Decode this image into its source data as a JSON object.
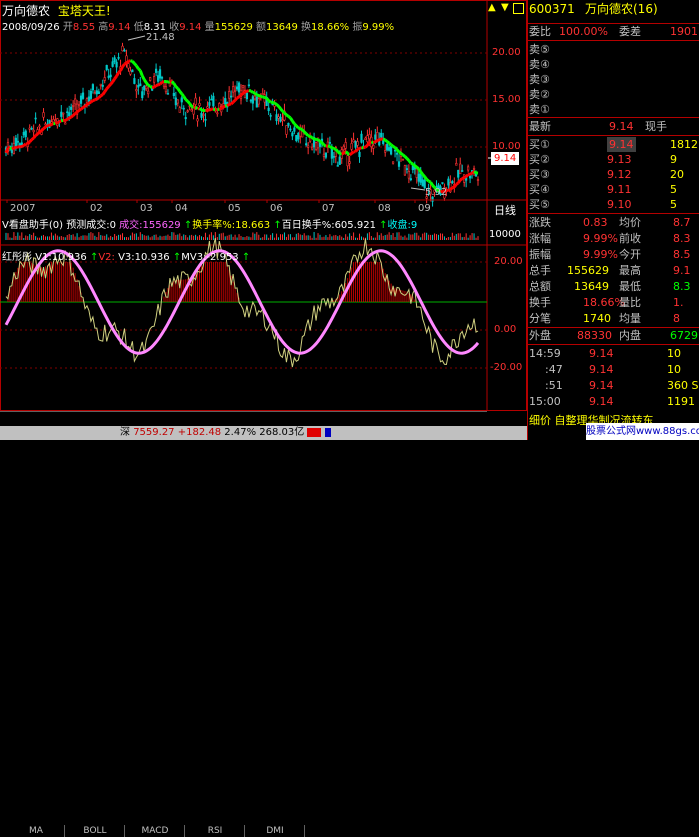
{
  "stock": {
    "name": "万向德农",
    "slogan": "宝塔天王!"
  },
  "info_line": {
    "date": "2008/09/26",
    "open_label": "开",
    "open": "8.55",
    "high_label": "高",
    "high": "9.14",
    "low_label": "低",
    "low": "8.31",
    "close_label": "收",
    "close": "9.14",
    "vol_label": "量",
    "vol": "155629",
    "amt_label": "额",
    "amt": "13649",
    "turn_label": "换",
    "turn": "18.66%",
    "amp_label": "振",
    "amp": "9.99%"
  },
  "main_chart": {
    "y_ticks": [
      "20.00",
      "15.00",
      "10.00"
    ],
    "max_label": "21.48",
    "min_label": "5.92",
    "last_price_tag": "9.14",
    "x_labels": [
      "2007",
      "02",
      "03",
      "04",
      "05",
      "06",
      "07",
      "08",
      "09"
    ],
    "period_label": "日线"
  },
  "volume_panel": {
    "title": "V看盘助手(0)",
    "pred_label": "预测成交:0",
    "vol_label": "成交:155629",
    "turn_label": "换手率%:18.663",
    "hundred_turn_label": "百日换手%:605.921",
    "extra_label": "收盘:9",
    "y_tick": "10000"
  },
  "indicator_panel": {
    "title": "红彤彤",
    "v1": "V1:10.936",
    "v2": "V2:",
    "v3": "V3:10.936",
    "mv3": "MV3:-2.953",
    "y_ticks": [
      "20.00",
      "0.00",
      "-20.00"
    ]
  },
  "bottom_tabs": [
    "MA",
    "BOLL",
    "MACD",
    "RSI",
    "DMI"
  ],
  "bottom_strip": {
    "left": "深",
    "value": "7559.27",
    "change": "+182.48",
    "pct": "2.47%",
    "amount": "268.03亿"
  },
  "quote": {
    "code": "600371",
    "name": "万向德农(16)",
    "wb_label": "委比",
    "wb_value": "100.00%",
    "wc_label": "委差",
    "wc_value": "1901",
    "sell": [
      {
        "label": "卖⑤",
        "price": "",
        "vol": ""
      },
      {
        "label": "卖④",
        "price": "",
        "vol": ""
      },
      {
        "label": "卖③",
        "price": "",
        "vol": ""
      },
      {
        "label": "卖②",
        "price": "",
        "vol": ""
      },
      {
        "label": "卖①",
        "price": "",
        "vol": ""
      }
    ],
    "latest_label": "最新",
    "latest": "9.14",
    "xianshou_label": "现手",
    "xianshou": "",
    "buy": [
      {
        "label": "买①",
        "price": "9.14",
        "vol": "1812"
      },
      {
        "label": "买②",
        "price": "9.13",
        "vol": "9"
      },
      {
        "label": "买③",
        "price": "9.12",
        "vol": "20"
      },
      {
        "label": "买④",
        "price": "9.11",
        "vol": "5"
      },
      {
        "label": "买⑤",
        "price": "9.10",
        "vol": "5"
      }
    ],
    "stats": [
      {
        "l1": "涨跌",
        "v1": "0.83",
        "l2": "均价",
        "v2": "8.7"
      },
      {
        "l1": "涨幅",
        "v1": "9.99%",
        "l2": "前收",
        "v2": "8.3"
      },
      {
        "l1": "振幅",
        "v1": "9.99%",
        "l2": "今开",
        "v2": "8.5"
      },
      {
        "l1": "总手",
        "v1": "155629",
        "l2": "最高",
        "v2": "9.1"
      },
      {
        "l1": "总额",
        "v1": "13649",
        "l2": "最低",
        "v2": "8.3"
      },
      {
        "l1": "换手",
        "v1": "18.66%",
        "l2": "量比",
        "v2": "1."
      },
      {
        "l1": "分笔",
        "v1": "1740",
        "l2": "均量",
        "v2": "8"
      }
    ],
    "outer_label": "外盘",
    "outer": "88330",
    "inner_label": "内盘",
    "inner": "6729",
    "ticks": [
      {
        "time": "14:59",
        "price": "9.14",
        "vol": "10"
      },
      {
        "time": ":47",
        "price": "9.14",
        "vol": "10"
      },
      {
        "time": ":51",
        "price": "9.14",
        "vol": "360 S"
      },
      {
        "time": "15:00",
        "price": "9.14",
        "vol": "1191"
      }
    ],
    "footer": "细价 自整理华制况流转东",
    "watermark": "股票公式网www.88gs.com"
  },
  "colors": {
    "up": "#ff3232",
    "down": "#00ffff",
    "ma_up": "#ff0000",
    "ma_down": "#00ff00",
    "grid": "#800000"
  }
}
